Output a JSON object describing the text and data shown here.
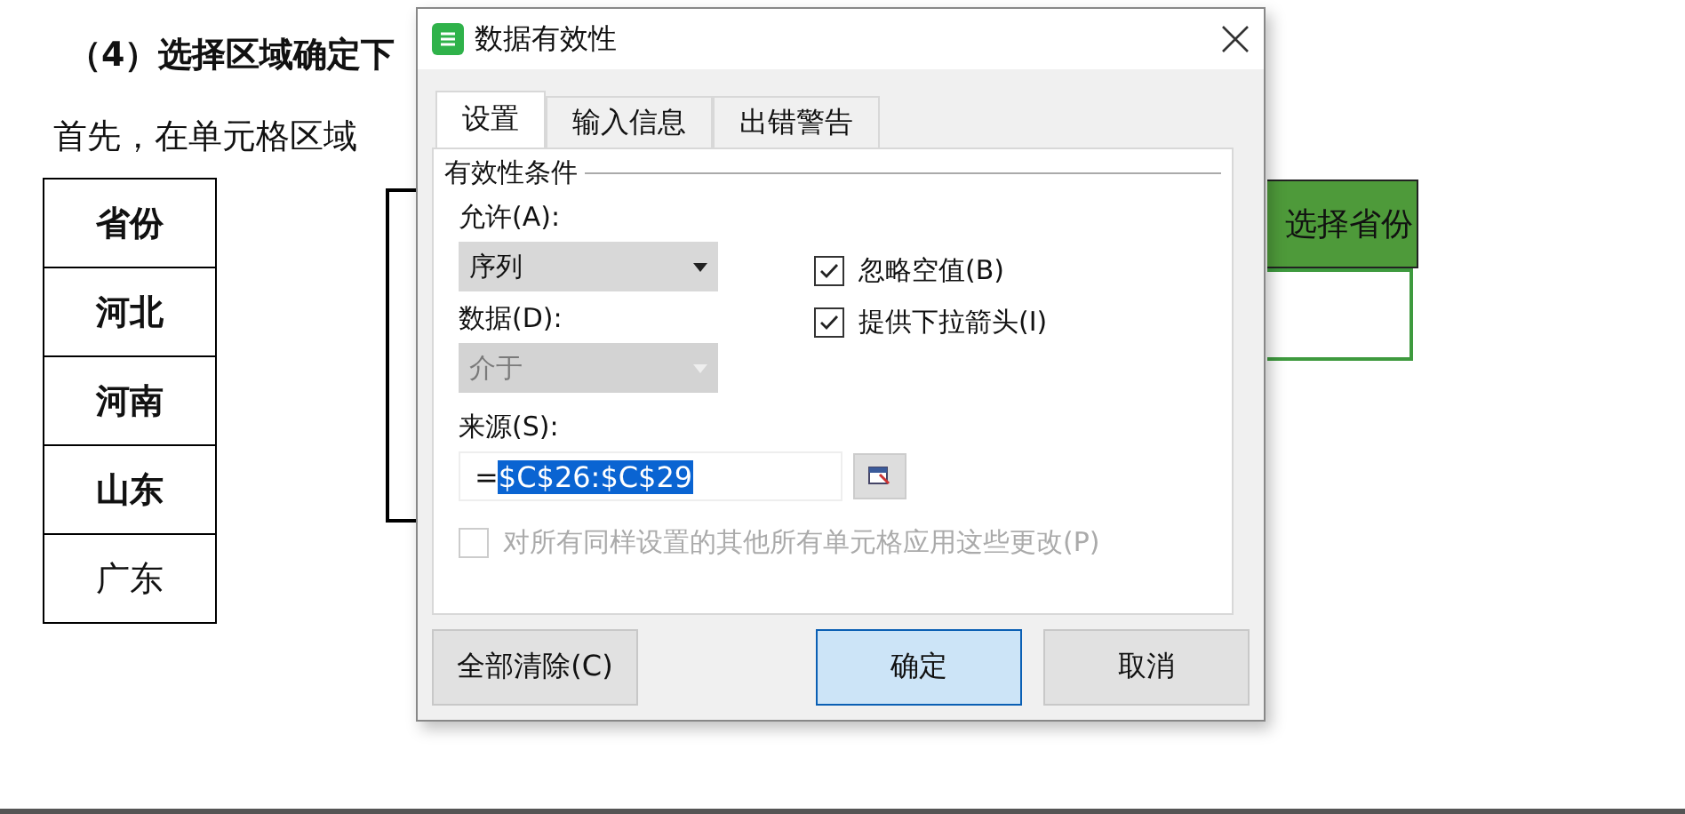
{
  "document": {
    "heading": "（4）选择区域确定下",
    "paragraph": "首先，在单元格区域",
    "table": [
      {
        "text": "省份",
        "bold": true
      },
      {
        "text": "河北",
        "bold": true
      },
      {
        "text": "河南",
        "bold": true
      },
      {
        "text": "山东",
        "bold": true
      },
      {
        "text": "广东",
        "bold": false
      }
    ],
    "target_header": "选择省份"
  },
  "dialog": {
    "title": "数据有效性",
    "tabs": [
      {
        "label": "设置",
        "selected": true
      },
      {
        "label": "输入信息",
        "selected": false
      },
      {
        "label": "出错警告",
        "selected": false
      }
    ],
    "group_title": "有效性条件",
    "allow": {
      "label": "允许(A):",
      "value": "序列",
      "disabled": false
    },
    "data": {
      "label": "数据(D):",
      "value": "介于",
      "disabled": true
    },
    "checkboxes": [
      {
        "label": "忽略空值(B)",
        "checked": true
      },
      {
        "label": "提供下拉箭头(I)",
        "checked": true
      }
    ],
    "source": {
      "label": "来源(S):",
      "prefix": "=",
      "value": "$C$26:$C$29"
    },
    "apply_all": {
      "label": "对所有同样设置的其他所有单元格应用这些更改(P)",
      "checked": false,
      "disabled": true
    },
    "buttons": [
      {
        "label": "全部清除(C)",
        "kind": "plain"
      },
      {
        "label": "确定",
        "kind": "default"
      },
      {
        "label": "取消",
        "kind": "plain"
      }
    ]
  }
}
